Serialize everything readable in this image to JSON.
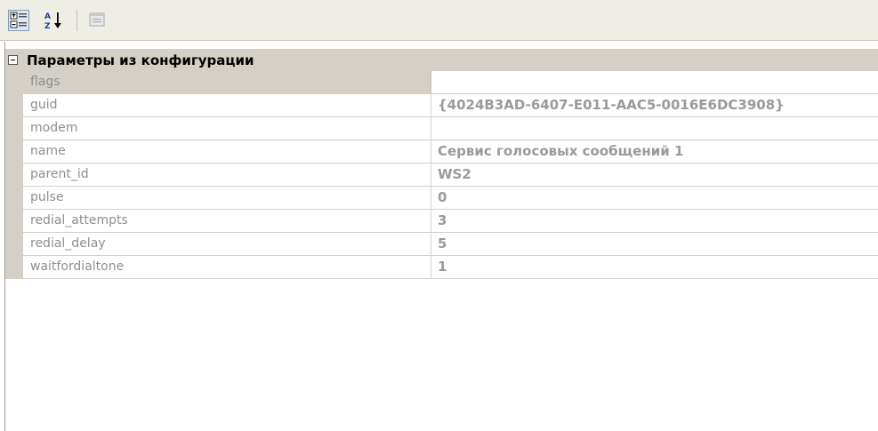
{
  "toolbar": {
    "buttons": [
      {
        "name": "categorized-view",
        "icon": "categorized-icon",
        "pressed": true
      },
      {
        "name": "alphabetical-sort",
        "icon": "sort-az-icon",
        "pressed": false
      },
      {
        "name": "property-pages",
        "icon": "property-pages-icon",
        "pressed": false
      }
    ]
  },
  "category": {
    "title": "Параметры из конфигурации",
    "expanded": true
  },
  "properties": [
    {
      "name": "flags",
      "value": ""
    },
    {
      "name": "guid",
      "value": "{4024B3AD-6407-E011-AAC5-0016E6DC3908}"
    },
    {
      "name": "modem",
      "value": ""
    },
    {
      "name": "name",
      "value": "Сервис голосовых сообщений 1"
    },
    {
      "name": "parent_id",
      "value": "WS2"
    },
    {
      "name": "pulse",
      "value": "0"
    },
    {
      "name": "redial_attempts",
      "value": "3"
    },
    {
      "name": "redial_delay",
      "value": "5"
    },
    {
      "name": "waitfordialtone",
      "value": "1"
    }
  ],
  "colors": {
    "toolbar_bg": "#efeee6",
    "category_bg": "#d4d0c8",
    "name_text": "#8f8f8f",
    "value_text": "#9a9a9a"
  }
}
